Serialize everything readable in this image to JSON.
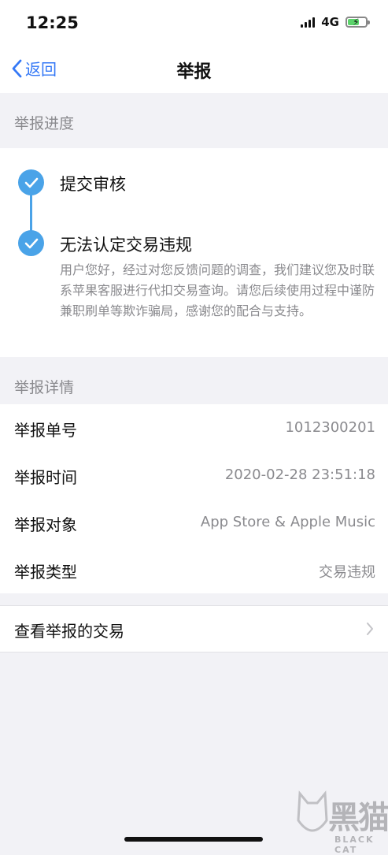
{
  "status_bar": {
    "time": "12:25",
    "network": "4G"
  },
  "nav": {
    "back_label": "返回",
    "title": "举报"
  },
  "progress_section": {
    "header": "举报进度",
    "steps": [
      {
        "title": "提交审核"
      },
      {
        "title": "无法认定交易违规",
        "description": "用户您好，经过对您反馈问题的调查，我们建议您及时联系苹果客服进行代扣交易查询。请您后续使用过程中谨防兼职刷单等欺诈骗局，感谢您的配合与支持。"
      }
    ]
  },
  "details_section": {
    "header": "举报详情",
    "rows": [
      {
        "label": "举报单号",
        "value": "1012300201"
      },
      {
        "label": "举报时间",
        "value": "2020-02-28 23:51:18"
      },
      {
        "label": "举报对象",
        "value": "App Store & Apple Music"
      },
      {
        "label": "举报类型",
        "value": "交易违规"
      }
    ]
  },
  "link": {
    "label": "查看举报的交易"
  },
  "watermark": {
    "cn": "黑猫",
    "en": "BLACK CAT"
  },
  "colors": {
    "accent": "#3478f6",
    "check": "#4aa3e8",
    "battery": "#5bd36a"
  }
}
